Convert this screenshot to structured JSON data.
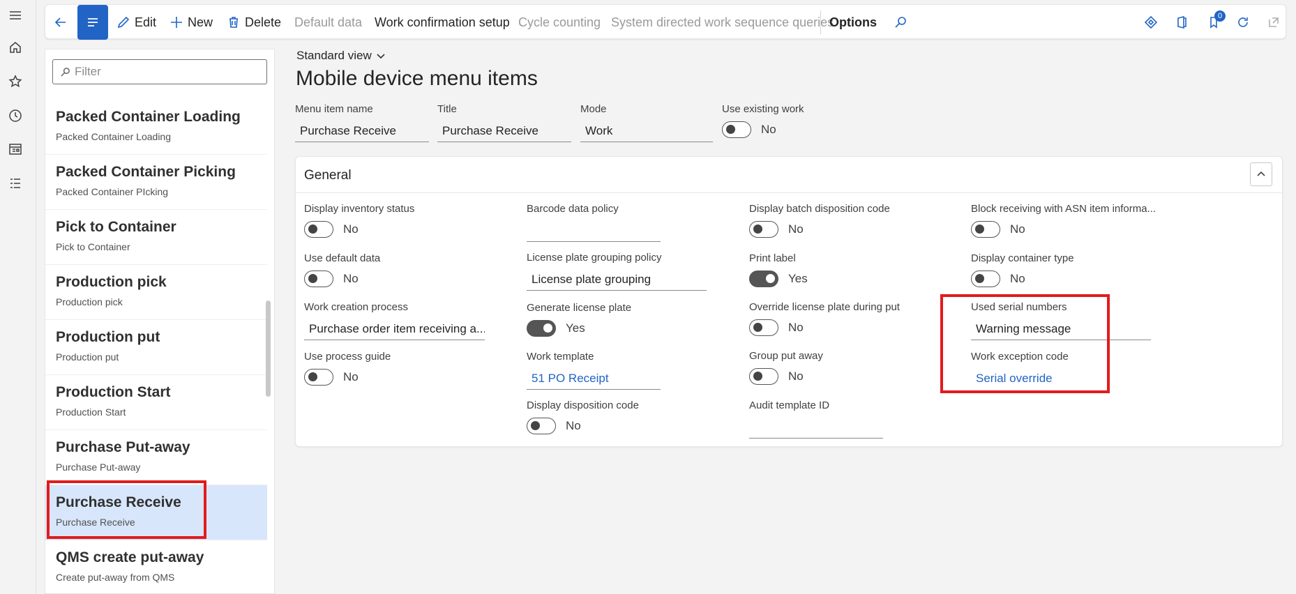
{
  "actionbar": {
    "edit": "Edit",
    "new": "New",
    "delete": "Delete",
    "default_data": "Default data",
    "work_confirmation_setup": "Work confirmation setup",
    "cycle_counting": "Cycle counting",
    "system_directed": "System directed work sequence queries",
    "options": "Options",
    "notification_count": "0"
  },
  "filter": {
    "placeholder": "Filter"
  },
  "list": [
    {
      "title": "Packed Container Loading",
      "subtitle": "Packed Container Loading"
    },
    {
      "title": "Packed Container Picking",
      "subtitle": "Packed Container PIcking"
    },
    {
      "title": "Pick to Container",
      "subtitle": "Pick to Container"
    },
    {
      "title": "Production pick",
      "subtitle": "Production pick"
    },
    {
      "title": "Production put",
      "subtitle": "Production put"
    },
    {
      "title": "Production Start",
      "subtitle": "Production Start"
    },
    {
      "title": "Purchase Put-away",
      "subtitle": "Purchase Put-away"
    },
    {
      "title": "Purchase Receive",
      "subtitle": "Purchase Receive",
      "selected": true
    },
    {
      "title": "QMS create put-away",
      "subtitle": "Create put-away from QMS"
    }
  ],
  "page": {
    "view": "Standard view",
    "title": "Mobile device menu items"
  },
  "header": {
    "menu_item_name": {
      "label": "Menu item name",
      "value": "Purchase Receive"
    },
    "title": {
      "label": "Title",
      "value": "Purchase Receive"
    },
    "mode": {
      "label": "Mode",
      "value": "Work"
    },
    "use_existing_work": {
      "label": "Use existing work",
      "value": "No"
    }
  },
  "general": {
    "title": "General",
    "col1": {
      "display_inventory_status": {
        "label": "Display inventory status",
        "value": "No"
      },
      "use_default_data": {
        "label": "Use default data",
        "value": "No"
      },
      "work_creation_process": {
        "label": "Work creation process",
        "value": "Purchase order item receiving a..."
      },
      "use_process_guide": {
        "label": "Use process guide",
        "value": "No"
      }
    },
    "col2": {
      "barcode_data_policy": {
        "label": "Barcode data policy",
        "value": ""
      },
      "license_plate_grouping_policy": {
        "label": "License plate grouping policy",
        "value": "License plate grouping"
      },
      "generate_license_plate": {
        "label": "Generate license plate",
        "value": "Yes"
      },
      "work_template": {
        "label": "Work template",
        "value": "51 PO Receipt"
      },
      "display_disposition_code": {
        "label": "Display disposition code",
        "value": "No"
      }
    },
    "col3": {
      "display_batch_disposition_code": {
        "label": "Display batch disposition code",
        "value": "No"
      },
      "print_label": {
        "label": "Print label",
        "value": "Yes"
      },
      "override_license_plate": {
        "label": "Override license plate during put",
        "value": "No"
      },
      "group_put_away": {
        "label": "Group put away",
        "value": "No"
      },
      "audit_template_id": {
        "label": "Audit template ID",
        "value": ""
      }
    },
    "col4": {
      "block_receiving": {
        "label": "Block receiving with ASN item informa...",
        "value": "No"
      },
      "display_container_type": {
        "label": "Display container type",
        "value": "No"
      },
      "used_serial_numbers": {
        "label": "Used serial numbers",
        "value": "Warning message"
      },
      "work_exception_code": {
        "label": "Work exception code",
        "value": "Serial override"
      }
    }
  },
  "colors": {
    "accent": "#2264c5",
    "highlight": "#e21b1b",
    "selected_row": "#d8e6fb"
  }
}
